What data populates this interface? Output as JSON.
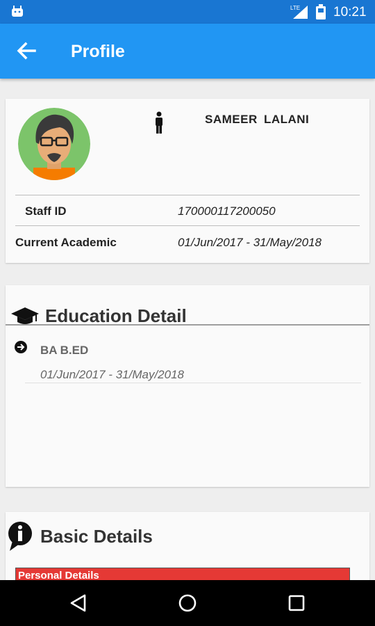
{
  "status_bar": {
    "time": "10:21",
    "network_label": "LTE",
    "icons": [
      "android-icon",
      "signal-icon",
      "battery-icon"
    ]
  },
  "app_bar": {
    "title": "Profile",
    "back_icon": "arrow-left-icon",
    "background": "#2196f3"
  },
  "profile": {
    "name": "SAMEER  LALANI",
    "gender_icon": "person-icon",
    "fields": [
      {
        "label": "Staff ID",
        "value": "170000117200050"
      },
      {
        "label": "Current Academic",
        "value": "01/Jun/2017 - 31/May/2018"
      }
    ]
  },
  "education": {
    "title": "Education Detail",
    "icon": "graduation-cap-icon",
    "items": [
      {
        "degree": "BA B.ED",
        "dates": "01/Jun/2017 - 31/May/2018"
      }
    ]
  },
  "basic_details": {
    "title": "Basic Details",
    "icon": "info-icon",
    "subsection": "Personal Details",
    "subsection_color": "#e53935"
  },
  "nav_bar": {
    "buttons": [
      "back-triangle-icon",
      "home-circle-icon",
      "recents-square-icon"
    ]
  }
}
